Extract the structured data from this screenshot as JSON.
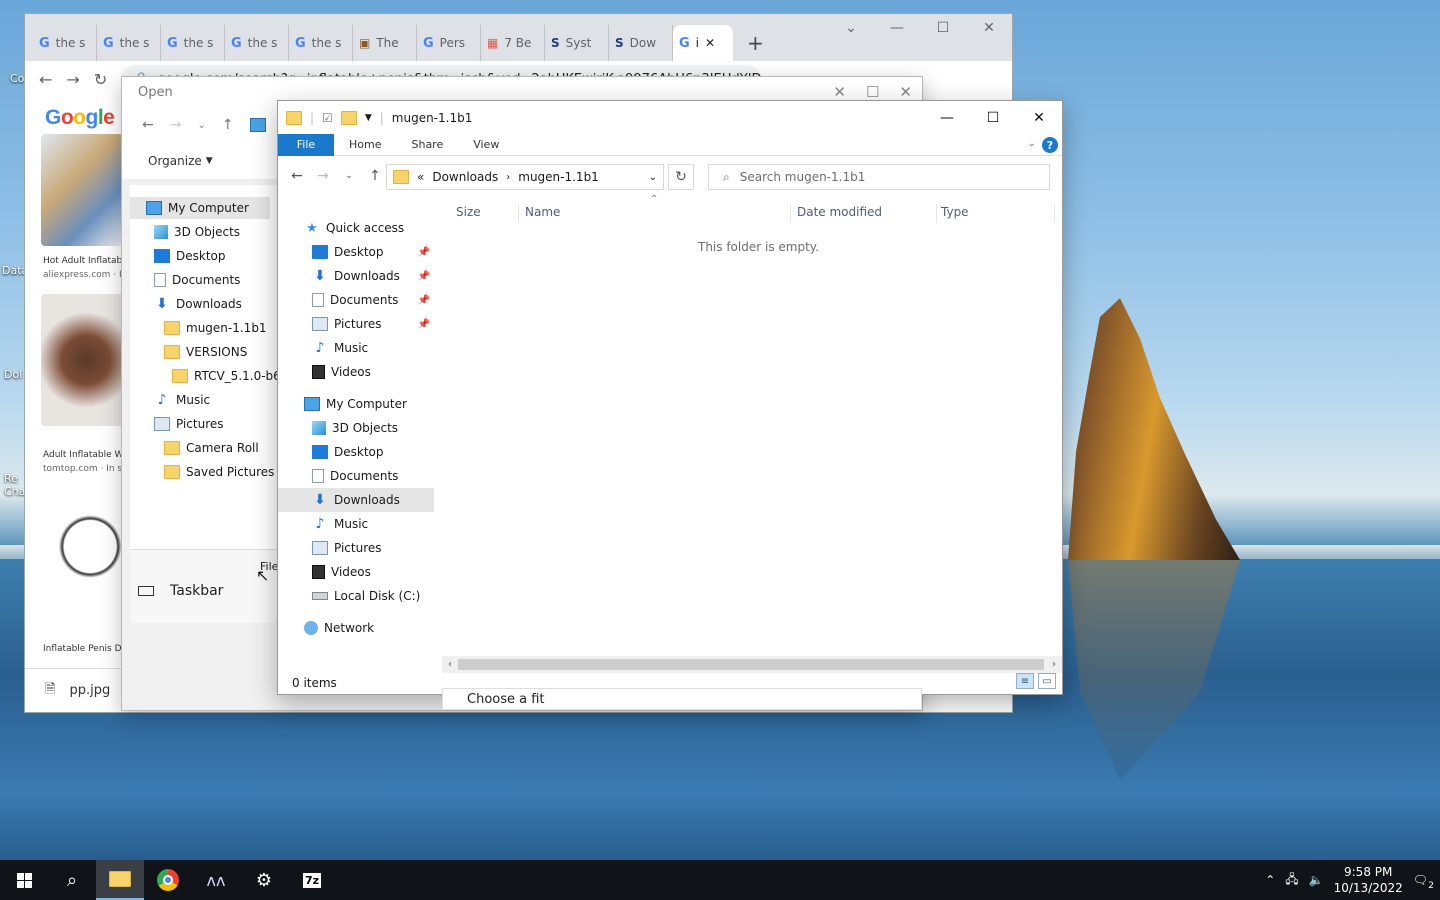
{
  "chrome": {
    "tabs": [
      {
        "label": "the s"
      },
      {
        "label": "the s"
      },
      {
        "label": "the s"
      },
      {
        "label": "the s"
      },
      {
        "label": "the s"
      },
      {
        "label": "The"
      },
      {
        "label": "Pers"
      },
      {
        "label": "7 Be"
      },
      {
        "label": "Syst"
      },
      {
        "label": "Dow"
      },
      {
        "label": "i"
      }
    ],
    "url": "google.com/search?q=inflatable+penis&tbm=isch&ved=2ahUKEwiriK-a9976AhU6p3IEHdYID_UQ",
    "logo": "Google",
    "results": [
      {
        "caption": "Hot Adult Inflatab",
        "source": "aliexpress.com · In"
      },
      {
        "caption": "Adult Inflatable W",
        "source": "tomtop.com · In sto"
      },
      {
        "caption": "Inflatable Penis D",
        "source": ""
      }
    ],
    "download_file": "pp.jpg"
  },
  "open_dialog": {
    "title": "Open",
    "organize": "Organize",
    "tree": [
      {
        "label": "My Computer",
        "icon": "monitor"
      },
      {
        "label": "3D Objects",
        "icon": "cube"
      },
      {
        "label": "Desktop",
        "icon": "desk"
      },
      {
        "label": "Documents",
        "icon": "doc"
      },
      {
        "label": "Downloads",
        "icon": "download"
      },
      {
        "label": "mugen-1.1b1",
        "icon": "folder"
      },
      {
        "label": "VERSIONS",
        "icon": "folder"
      },
      {
        "label": "RTCV_5.1.0-b6",
        "icon": "folder"
      },
      {
        "label": "Music",
        "icon": "music"
      },
      {
        "label": "Pictures",
        "icon": "pic"
      },
      {
        "label": "Camera Roll",
        "icon": "folder"
      },
      {
        "label": "Saved Pictures",
        "icon": "folder"
      }
    ],
    "file_label": "File",
    "taskbar_label": "Taskbar"
  },
  "explorer": {
    "title": "mugen-1.1b1",
    "ribbon": {
      "file": "File",
      "home": "Home",
      "share": "Share",
      "view": "View",
      "help": "?"
    },
    "breadcrumb": {
      "prefix": "«",
      "parent": "Downloads",
      "current": "mugen-1.1b1"
    },
    "search_placeholder": "Search mugen-1.1b1",
    "nav": {
      "quick_access": "Quick access",
      "quick_items": [
        "Desktop",
        "Downloads",
        "Documents",
        "Pictures",
        "Music",
        "Videos"
      ],
      "my_computer": "My Computer",
      "computer_items": [
        "3D Objects",
        "Desktop",
        "Documents",
        "Downloads",
        "Music",
        "Pictures",
        "Videos",
        "Local Disk (C:)"
      ],
      "network": "Network"
    },
    "columns": [
      "Size",
      "Name",
      "Date modified",
      "Type"
    ],
    "empty_message": "This folder is empty.",
    "status": "0 items"
  },
  "choose_fit": "Choose a fit",
  "desktop_labels": [
    "Co",
    "Data",
    "Dol",
    "Re Cha"
  ],
  "taskbar": {
    "time": "9:58 PM",
    "date": "10/13/2022",
    "notifications": "2"
  }
}
